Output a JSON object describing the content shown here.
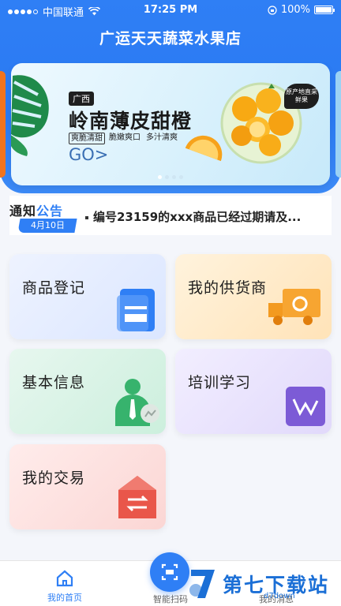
{
  "status": {
    "carrier": "中国联通",
    "time": "17:25 PM",
    "battery": "100%"
  },
  "app": {
    "title": "广运天天蔬菜水果店"
  },
  "banner": {
    "tag": "广西",
    "headline": "岭南薄皮甜橙",
    "sub1": "爽脆清甜",
    "sub2": "脆嫩爽口",
    "sub3": "多汁清爽",
    "go": "GO>",
    "badge": "原产地直采鲜果"
  },
  "notice": {
    "label_part1": "通知",
    "label_part2": "公告",
    "date": "4月10日",
    "text": "编号23159的xxx商品已经过期请及..."
  },
  "cards": {
    "c1": "商品登记",
    "c2": "我的供货商",
    "c3": "基本信息",
    "c4": "培训学习",
    "c5": "我的交易"
  },
  "tabbar": {
    "home": "我的首页",
    "scan": "智能扫码",
    "msg": "我的消息"
  },
  "watermark": {
    "text": "第七下载站",
    "sub": "d7down"
  },
  "colors": {
    "primary": "#2f7ff5",
    "orange": "#f2741d"
  }
}
